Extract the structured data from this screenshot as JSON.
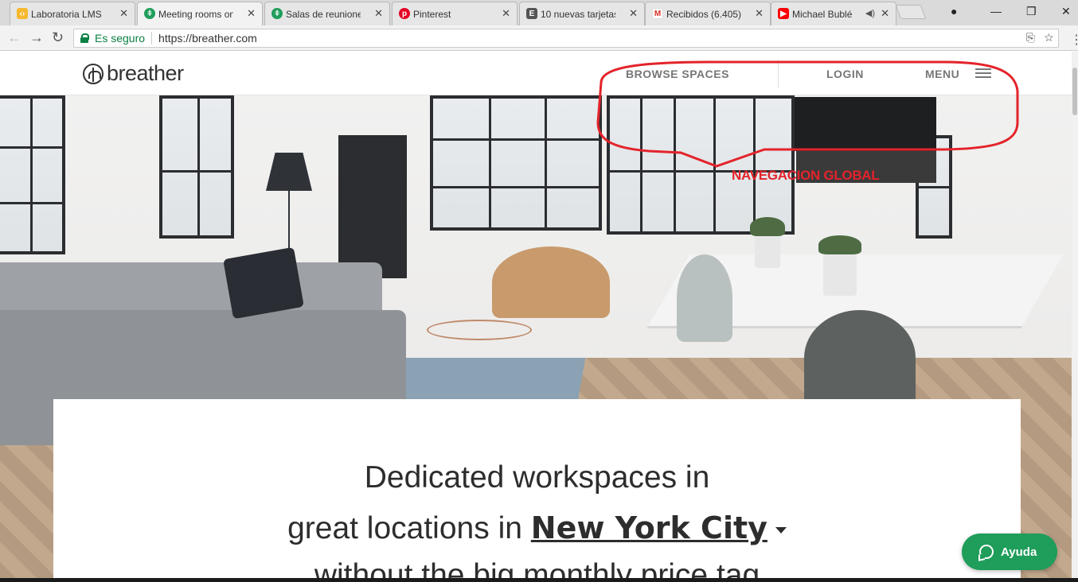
{
  "browser": {
    "tabs": [
      {
        "title": "Laboratoria LMS",
        "favicon_color": "#f5b82e",
        "favicon": "lms-icon",
        "active": false
      },
      {
        "title": "Meeting rooms on",
        "favicon_color": "#1f9d5a",
        "favicon": "breather-icon",
        "active": true
      },
      {
        "title": "Salas de reuniones",
        "favicon_color": "#1f9d5a",
        "favicon": "breather-icon",
        "active": false
      },
      {
        "title": "Pinterest",
        "favicon_color": "#e60023",
        "favicon": "pinterest-icon",
        "active": false
      },
      {
        "title": "10 nuevas tarjetas",
        "favicon_color": "#555555",
        "favicon": "ie-icon",
        "active": false
      },
      {
        "title": "Recibidos (6.405) -",
        "favicon_color": "#d93025",
        "favicon": "gmail-icon",
        "active": false
      },
      {
        "title": "Michael Bublé",
        "favicon_color": "#ff0000",
        "favicon": "youtube-icon",
        "active": false
      }
    ],
    "secure_label": "Es seguro",
    "url": "https://breather.com"
  },
  "site": {
    "logo_text": "breather",
    "nav": {
      "browse": "BROWSE SPACES",
      "login": "LOGIN",
      "menu": "MENU"
    },
    "headline": {
      "line1": "Dedicated workspaces in",
      "line2_prefix": "great locations in",
      "city": "New York City",
      "line3": "without the big monthly price tag"
    },
    "help_label": "Ayuda"
  },
  "annotation": {
    "label": "NAVEGACION GLOBAL",
    "color": "#e4232b"
  },
  "colors": {
    "brand_green": "#1f9d5a",
    "nav_text": "#777777"
  }
}
